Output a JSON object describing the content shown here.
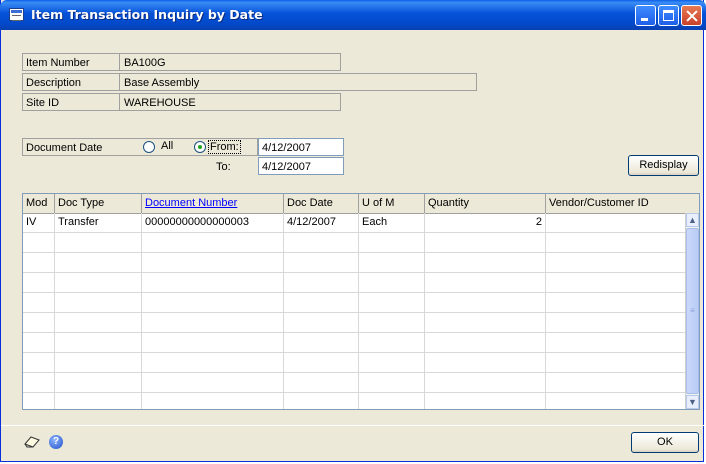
{
  "window": {
    "title": "Item Transaction Inquiry by Date"
  },
  "item": {
    "number_label": "Item Number",
    "number_value": "BA100G",
    "description_label": "Description",
    "description_value": "Base Assembly",
    "site_label": "Site ID",
    "site_value": "WAREHOUSE"
  },
  "date_filter": {
    "label": "Document Date",
    "all_label": "All",
    "from_label": "From:",
    "from_value": "4/12/2007",
    "to_label": "To:",
    "to_value": "4/12/2007",
    "selected": "From"
  },
  "buttons": {
    "redisplay": "Redisplay",
    "ok": "OK"
  },
  "grid": {
    "columns": [
      "Mod",
      "Doc Type",
      "Document Number",
      "Doc Date",
      "U of M",
      "Quantity",
      "Vendor/Customer ID"
    ],
    "rows": [
      [
        "IV",
        "Transfer",
        "00000000000000003",
        "4/12/2007",
        "Each",
        "2",
        ""
      ]
    ]
  },
  "icons": {
    "note": "note-icon",
    "help": "help-icon",
    "help_glyph": "?"
  },
  "colors": {
    "title_bar": "#0552d9",
    "link": "#0000ff"
  }
}
